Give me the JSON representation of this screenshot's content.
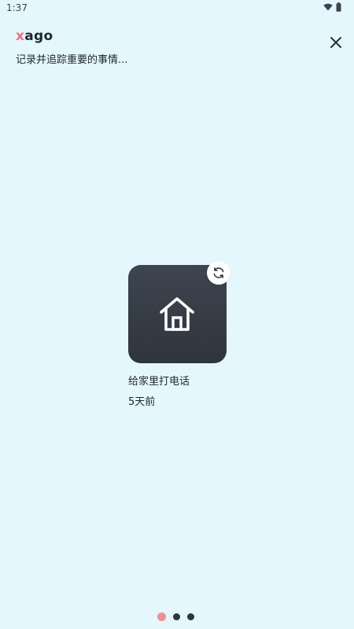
{
  "status_bar": {
    "time": "1:37",
    "icons": [
      "wifi-icon",
      "battery-icon"
    ]
  },
  "header": {
    "brand_x": "x",
    "brand_rest": "ago",
    "tagline": "记录并追踪重要的事情...",
    "close_icon": "close-icon"
  },
  "card": {
    "icon": "home-icon",
    "action_icon": "refresh-icon",
    "title": "给家里打电话",
    "age": "5天前"
  },
  "pager": {
    "count": 3,
    "active_index": 0
  },
  "colors": {
    "background": "#e4f7fc",
    "brand_accent": "#ee6f76",
    "card": "#363c46",
    "active_dot": "#ef8f96"
  }
}
